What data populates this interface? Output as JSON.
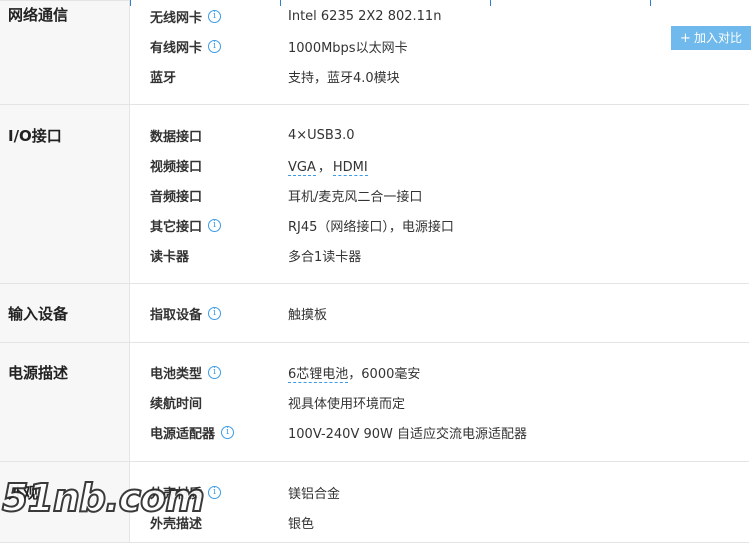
{
  "compare_button": {
    "label": "加入对比"
  },
  "info_icon_glyph": "i",
  "sections": {
    "network": {
      "title": "网络通信",
      "rows": [
        {
          "label": "无线网卡",
          "value": "Intel 6235 2X2 802.11n",
          "info": true
        },
        {
          "label": "有线网卡",
          "value": "1000Mbps以太网卡",
          "info": true
        },
        {
          "label": "蓝牙",
          "value": "支持，蓝牙4.0模块",
          "info": false
        }
      ]
    },
    "io": {
      "title": "I/O接口",
      "rows": [
        {
          "label": "数据接口",
          "value": "4×USB3.0",
          "info": false
        },
        {
          "label": "视频接口",
          "value_links": [
            "VGA",
            "HDMI"
          ],
          "separator": "，",
          "info": false
        },
        {
          "label": "音频接口",
          "value": "耳机/麦克风二合一接口",
          "info": false
        },
        {
          "label": "其它接口",
          "value": "RJ45（网络接口），电源接口",
          "info": true
        },
        {
          "label": "读卡器",
          "value": "多合1读卡器",
          "info": false
        }
      ]
    },
    "input": {
      "title": "输入设备",
      "rows": [
        {
          "label": "指取设备",
          "value": "触摸板",
          "info": true
        }
      ]
    },
    "power": {
      "title": "电源描述",
      "rows": [
        {
          "label": "电池类型",
          "value_link": "6芯锂电池",
          "value_rest": "，6000毫安",
          "info": true
        },
        {
          "label": "续航时间",
          "value": "视具体使用环境而定",
          "info": false
        },
        {
          "label": "电源适配器",
          "value": "100V-240V 90W 自适应交流电源适配器",
          "info": true
        }
      ]
    },
    "appearance": {
      "title": "外观",
      "rows": [
        {
          "label": "外壳材质",
          "value": "镁铝合金",
          "info": true
        },
        {
          "label": "外壳描述",
          "value": "银色",
          "info": false
        }
      ]
    }
  },
  "watermark": "51nb.com",
  "colors": {
    "accent": "#3c9be6",
    "compare_button_bg": "#6fb9ec",
    "title_bg": "#f7f7f7",
    "border": "#e4e4e4"
  }
}
